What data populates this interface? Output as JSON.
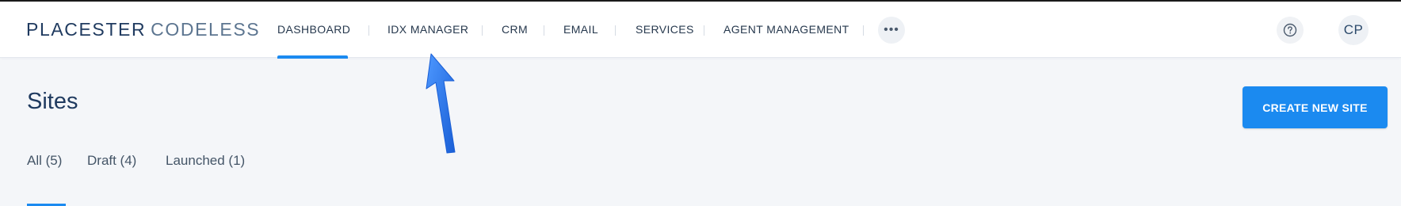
{
  "header": {
    "logo_primary": "PLACESTER",
    "logo_secondary": "CODELESS",
    "nav": [
      {
        "label": "DASHBOARD"
      },
      {
        "label": "IDX MANAGER"
      },
      {
        "label": "CRM"
      },
      {
        "label": "EMAIL"
      },
      {
        "label": "SERVICES"
      },
      {
        "label": "AGENT MANAGEMENT"
      }
    ],
    "active_nav": "DASHBOARD",
    "more_icon": "ellipsis-icon",
    "help_icon": "question-circle-icon",
    "avatar_initials": "CP"
  },
  "main": {
    "title": "Sites",
    "create_button": "CREATE NEW SITE",
    "filters": [
      {
        "label": "All (5)"
      },
      {
        "label": "Draft (4)"
      },
      {
        "label": "Launched (1)"
      }
    ],
    "active_filter": "All (5)"
  },
  "annotation": {
    "icon": "arrow-pointer-icon",
    "points_to": "IDX MANAGER"
  },
  "colors": {
    "accent": "#1b8af0",
    "text_dark": "#1f3a5f",
    "background": "#f4f6f9",
    "annotation_arrow": "#1f6fe0"
  }
}
